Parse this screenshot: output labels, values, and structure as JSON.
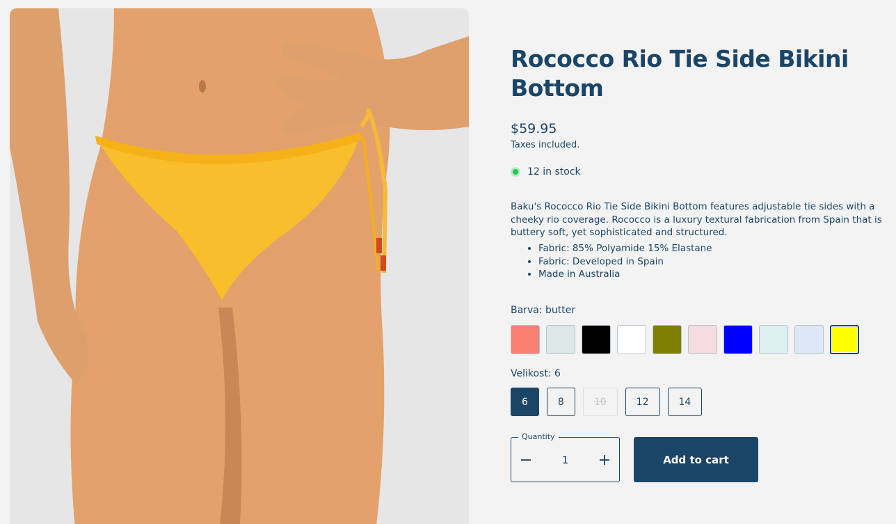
{
  "product": {
    "title": "Rococco Rio Tie Side Bikini Bottom",
    "price": "$59.95",
    "tax_note": "Taxes included.",
    "stock": "12 in stock",
    "description": "Baku's Rococco Rio Tie Side Bikini Bottom features adjustable tie sides with a cheeky rio coverage. Rococco is a luxury textural fabrication from Spain that is buttery soft, yet sophisticated and structured.",
    "bullets": [
      "Fabric: 85% Polyamide 15% Elastane",
      "Fabric: Developed in Spain",
      "Made in Australia"
    ]
  },
  "color_option": {
    "label": "Barva: butter",
    "swatches": [
      {
        "color": "#fa8072"
      },
      {
        "color": "#dce7e6"
      },
      {
        "color": "#000000"
      },
      {
        "color": "#ffffff"
      },
      {
        "color": "#7f8001"
      },
      {
        "color": "#f6dcdf"
      },
      {
        "color": "#0000ff"
      },
      {
        "color": "#dcf0f2"
      },
      {
        "color": "#dce8f7"
      },
      {
        "color": "#ffff00",
        "selected": true
      }
    ]
  },
  "size_option": {
    "label": "Velikost: 6",
    "sizes": [
      {
        "label": "6",
        "state": "selected"
      },
      {
        "label": "8",
        "state": "available"
      },
      {
        "label": "10",
        "state": "disabled"
      },
      {
        "label": "12",
        "state": "available"
      },
      {
        "label": "14",
        "state": "available"
      }
    ]
  },
  "quantity": {
    "legend": "Quantity",
    "value": "1"
  },
  "add_to_cart_label": "Add to cart",
  "icons": {
    "minus": "minus-icon",
    "plus": "plus-icon",
    "stock": "stock-dot-icon"
  }
}
